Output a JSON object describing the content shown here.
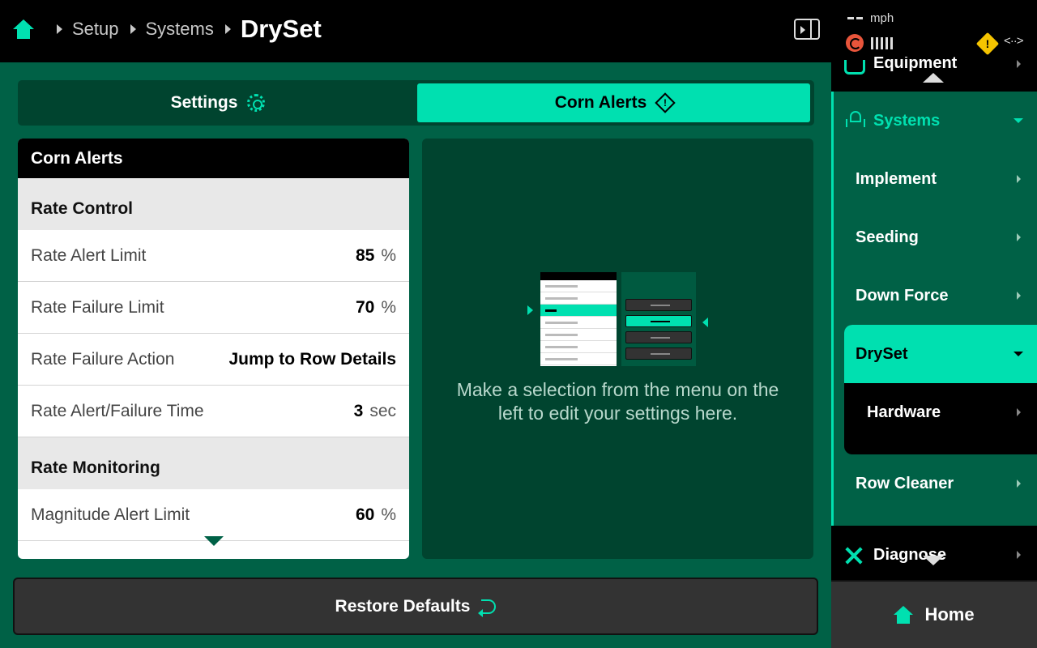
{
  "breadcrumb": {
    "items": [
      "Setup",
      "Systems"
    ],
    "current": "DrySet"
  },
  "status": {
    "speed_value": "-- ",
    "speed_unit": "mph"
  },
  "tabs": {
    "settings": "Settings",
    "corn_alerts": "Corn Alerts",
    "active": "Corn Alerts"
  },
  "list": {
    "title": "Corn Alerts",
    "sections": [
      {
        "title": "Rate Control",
        "rows": [
          {
            "label": "Rate Alert Limit",
            "value": "85",
            "unit": "%"
          },
          {
            "label": "Rate Failure Limit",
            "value": "70",
            "unit": "%"
          },
          {
            "label": "Rate Failure Action",
            "value": "Jump to Row Details",
            "unit": ""
          },
          {
            "label": "Rate Alert/Failure Time",
            "value": "3",
            "unit": "sec"
          }
        ]
      },
      {
        "title": "Rate Monitoring",
        "rows": [
          {
            "label": "Magnitude Alert Limit",
            "value": "60",
            "unit": "%"
          }
        ]
      }
    ]
  },
  "info": {
    "message": "Make a selection from the menu on the left to edit your settings here."
  },
  "restore_button": "Restore Defaults",
  "sidebar": {
    "equipment": "Equipment",
    "systems": "Systems",
    "system_items": [
      "Implement",
      "Seeding",
      "Down Force"
    ],
    "dryset": "DrySet",
    "hardware": "Hardware",
    "row_cleaner": "Row Cleaner",
    "diagnose": "Diagnose",
    "home": "Home"
  },
  "colors": {
    "accent": "#00e0b0",
    "background": "#006146",
    "panel": "#00442f",
    "warning": "#f5c400",
    "gps_alert": "#e8553b"
  },
  "icons": [
    "home-icon",
    "panel-toggle-icon",
    "gps-icon",
    "signal-icon",
    "warning-icon",
    "connection-icon",
    "gear-icon",
    "alert-diamond-icon",
    "undo-icon",
    "tractor-icon",
    "sprinkler-icon",
    "wrench-icon"
  ]
}
